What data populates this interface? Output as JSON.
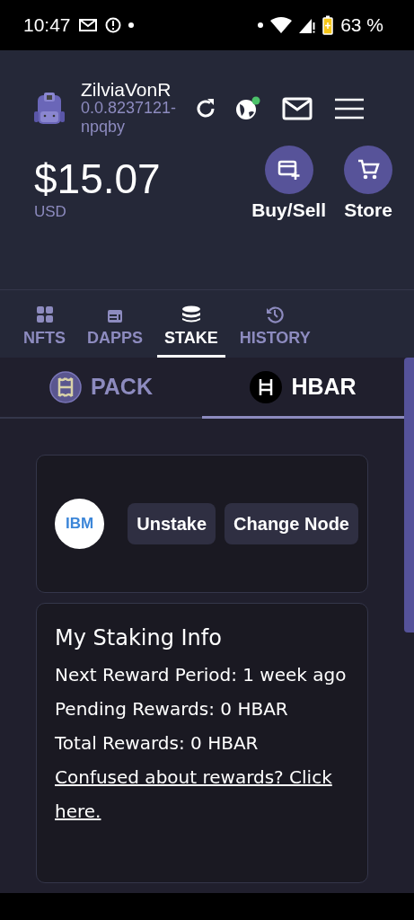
{
  "status_bar": {
    "time": "10:47",
    "battery": "63 %"
  },
  "account": {
    "name": "ZilviaVonR",
    "id": "0.0.8237121-npqby",
    "network_online": true
  },
  "balance": {
    "amount": "$15.07",
    "currency": "USD"
  },
  "actions": [
    {
      "kind": "card",
      "label": "Buy/Sell"
    },
    {
      "kind": "cart",
      "label": "Store"
    }
  ],
  "tabs": [
    {
      "kind": "grid",
      "label": "NFTS",
      "selected": false
    },
    {
      "kind": "app",
      "label": "DAPPS",
      "selected": false
    },
    {
      "kind": "coins",
      "label": "STAKE",
      "selected": true
    },
    {
      "kind": "history",
      "label": "HISTORY",
      "selected": false
    }
  ],
  "subtabs": [
    {
      "kind": "pack",
      "label": "PACK",
      "selected": false
    },
    {
      "kind": "hbar",
      "label": "HBAR",
      "selected": true
    }
  ],
  "node": {
    "logo": "IBM",
    "buttons": [
      "Unstake",
      "Change Node"
    ]
  },
  "staking_info": {
    "title": "My Staking Info",
    "lines": [
      "Next Reward Period: 1 week ago",
      "Pending Rewards: 0 HBAR",
      "Total Rewards: 0 HBAR"
    ],
    "link": "Confused about rewards? Click here."
  }
}
